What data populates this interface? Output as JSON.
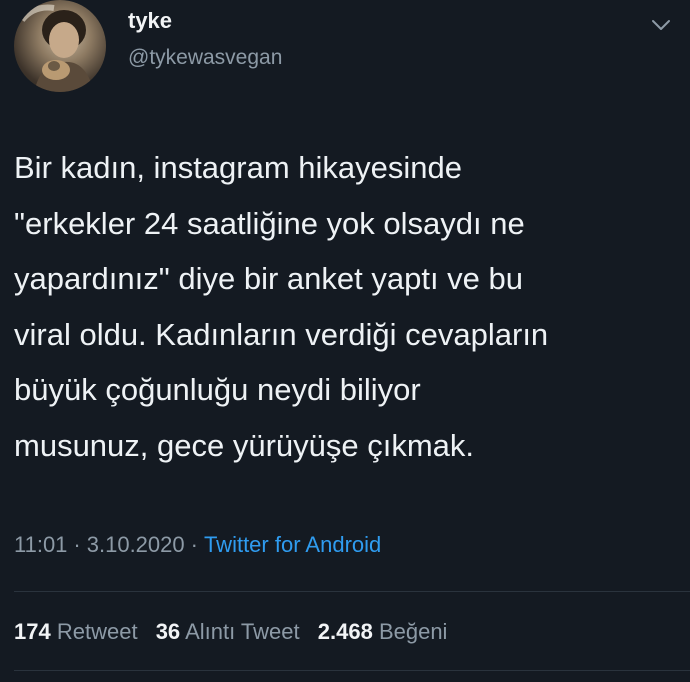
{
  "author": {
    "display_name": "tyke",
    "handle": "@tykewasvegan",
    "avatar_icon": "profile-photo"
  },
  "menu": {
    "icon": "chevron-down-icon"
  },
  "tweet": {
    "lines": [
      "Bir kadın, instagram hikayesinde",
      "\"erkekler 24 saatliğine yok olsaydı ne",
      "yapardınız\" diye bir anket yaptı ve bu",
      "viral oldu. Kadınların verdiği cevapların",
      "büyük çoğunluğu neydi biliyor",
      "musunuz, gece yürüyüşe çıkmak."
    ]
  },
  "meta": {
    "time": "11:01",
    "separator": "·",
    "date": "3.10.2020",
    "source": "Twitter for Android"
  },
  "stats": {
    "retweets": {
      "count": "174",
      "label": "Retweet"
    },
    "quotes": {
      "count": "36",
      "label": "Alıntı Tweet"
    },
    "likes": {
      "count": "2.468",
      "label": "Beğeni"
    }
  },
  "colors": {
    "background": "#141a22",
    "text": "#eef2f5",
    "muted": "#8d9aa6",
    "link": "#2f9cf0"
  }
}
